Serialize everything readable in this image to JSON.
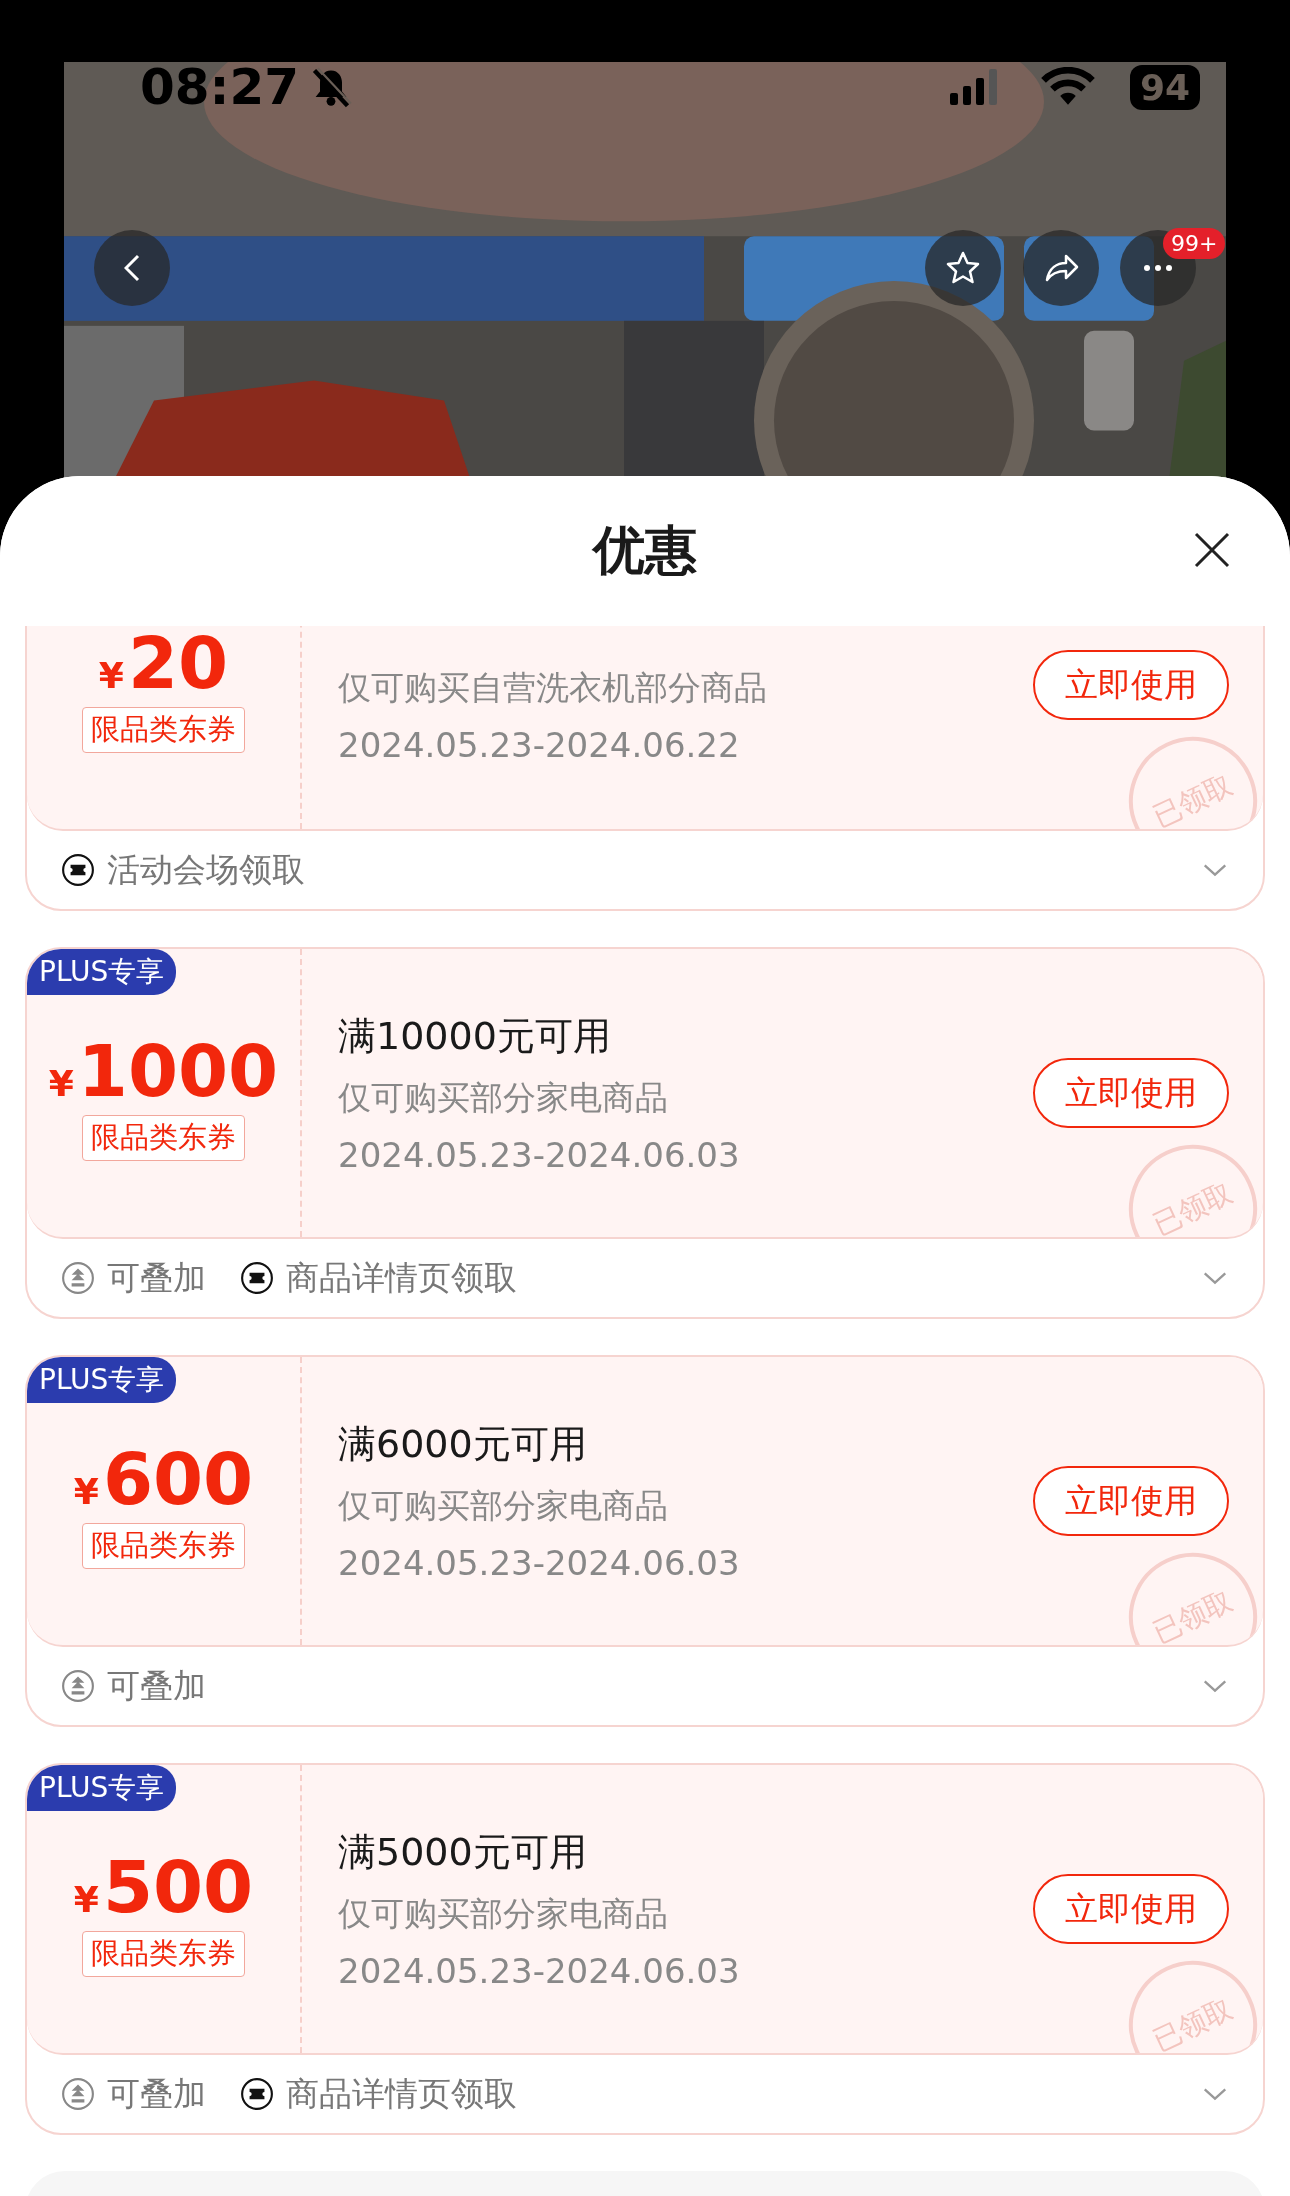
{
  "status_bar": {
    "time": "08:27",
    "muted": true,
    "battery": "94"
  },
  "nav": {
    "more_badge": "99+"
  },
  "sheet": {
    "title": "优惠"
  },
  "coupons": [
    {
      "currency": "¥",
      "amount": "20",
      "category": "限品类东券",
      "subtitle": "仅可购买自营洗衣机部分商品",
      "dates": "2024.05.23-2024.06.22",
      "action": "立即使用",
      "stamp": "已领取",
      "tags": [
        {
          "kind": "ticket",
          "text": "活动会场领取"
        }
      ]
    },
    {
      "plus_badge": "PLUS专享",
      "currency": "¥",
      "amount": "1000",
      "title": "满10000元可用",
      "category": "限品类东券",
      "subtitle": "仅可购买部分家电商品",
      "dates": "2024.05.23-2024.06.03",
      "action": "立即使用",
      "stamp": "已领取",
      "tags": [
        {
          "kind": "stack",
          "text": "可叠加"
        },
        {
          "kind": "ticket",
          "text": "商品详情页领取"
        }
      ]
    },
    {
      "plus_badge": "PLUS专享",
      "currency": "¥",
      "amount": "600",
      "title": "满6000元可用",
      "category": "限品类东券",
      "subtitle": "仅可购买部分家电商品",
      "dates": "2024.05.23-2024.06.03",
      "action": "立即使用",
      "stamp": "已领取",
      "tags": [
        {
          "kind": "stack",
          "text": "可叠加"
        }
      ]
    },
    {
      "plus_badge": "PLUS专享",
      "currency": "¥",
      "amount": "500",
      "title": "满5000元可用",
      "category": "限品类东券",
      "subtitle": "仅可购买部分家电商品",
      "dates": "2024.05.23-2024.06.03",
      "action": "立即使用",
      "stamp": "已领取",
      "tags": [
        {
          "kind": "stack",
          "text": "可叠加"
        },
        {
          "kind": "ticket",
          "text": "商品详情页领取"
        }
      ]
    }
  ]
}
